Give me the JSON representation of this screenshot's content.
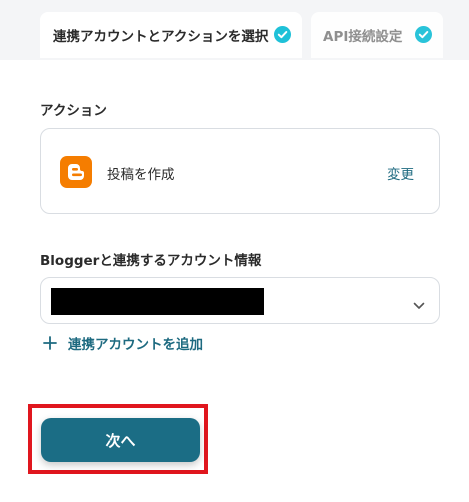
{
  "tabs": [
    {
      "label": "連携アカウントとアクションを選択",
      "status_icon": "check-circle-icon",
      "active": true
    },
    {
      "label": "API接続設定",
      "status_icon": "check-circle-icon",
      "active": false
    }
  ],
  "action_section": {
    "label": "アクション",
    "card": {
      "app_icon": "blogger-icon",
      "title": "投稿を作成",
      "change_label": "変更"
    }
  },
  "account_section": {
    "label": "Bloggerと連携するアカウント情報",
    "select": {
      "value_redacted": true,
      "chevron_icon": "chevron-down-icon"
    },
    "add_account_label": "連携アカウントを追加"
  },
  "next_button": {
    "label": "次へ"
  },
  "colors": {
    "accent": "#1b6d85",
    "link": "#1d6a80",
    "check": "#1fc1d8",
    "blogger": "#f57d00",
    "highlight": "#e0161e"
  }
}
